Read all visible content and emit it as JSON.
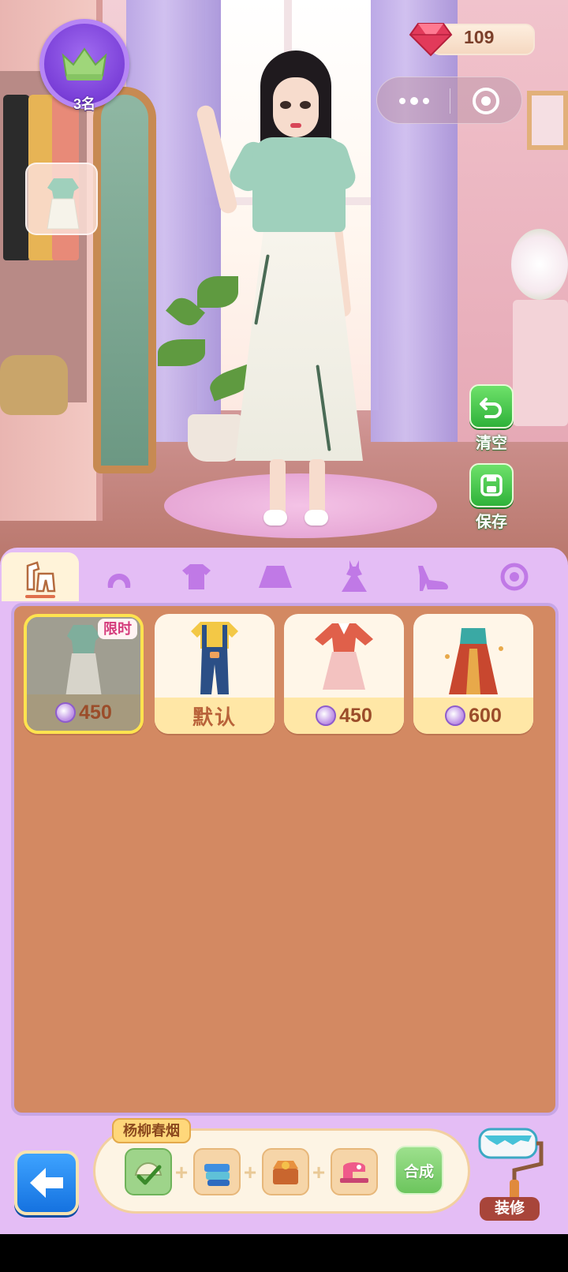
{
  "hud": {
    "rank_label": "3名",
    "gem_count": "109",
    "gem_color": "#e23a5a"
  },
  "side_actions": {
    "clear_label": "清空",
    "save_label": "保存"
  },
  "category_tabs": [
    {
      "icon": "outfit-set-icon",
      "active": true
    },
    {
      "icon": "hair-icon",
      "active": false
    },
    {
      "icon": "top-icon",
      "active": false
    },
    {
      "icon": "skirt-icon",
      "active": false
    },
    {
      "icon": "dress-icon",
      "active": false
    },
    {
      "icon": "high-heel-icon",
      "active": false
    },
    {
      "icon": "accessory-icon",
      "active": false
    }
  ],
  "items": [
    {
      "name": "bamboo-qipao-outfit",
      "price": "450",
      "tag": "限时",
      "selected": true
    },
    {
      "name": "overalls-outfit",
      "label": "默认",
      "selected": false
    },
    {
      "name": "red-pink-dress-outfit",
      "price": "450",
      "selected": false
    },
    {
      "name": "teal-red-hanfu-outfit",
      "price": "600",
      "selected": false
    }
  ],
  "recipe": {
    "title": "杨柳春烟",
    "synth_label": "合成",
    "plus": "+"
  },
  "bottom": {
    "decorate_label": "装修"
  },
  "colors": {
    "panel": "#e4bdf5",
    "grid": "#d38962",
    "accent_green": "#2fb23a",
    "back_blue": "#1572e0"
  }
}
